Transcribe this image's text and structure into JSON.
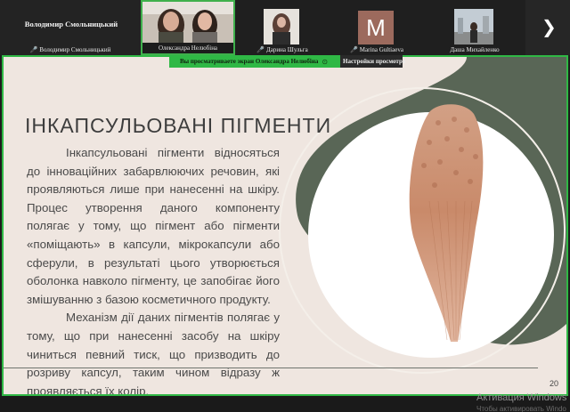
{
  "participants": {
    "featured": {
      "display_name": "Володимир Смольницький",
      "tile_label": "Володимир Смольницький"
    },
    "tiles": [
      {
        "label": "Олександра Нелюбіна",
        "muted": false,
        "active": true
      },
      {
        "label": "Дарина Шульга",
        "muted": true,
        "active": false
      },
      {
        "label": "Marina Gultiaeva",
        "muted": true,
        "active": false,
        "avatar_letter": "M"
      },
      {
        "label": "Даша Михайленко",
        "muted": false,
        "active": false
      }
    ]
  },
  "share_banner": {
    "text": "Вы просматриваете экран  Олександра Нелюбіна",
    "view_settings": "Настройки просмотра"
  },
  "slide": {
    "title": "ІНКАПСУЛЬОВАНІ ПІГМЕНТИ",
    "paragraph1": "Інкапсульовані пігменти відносяться до інноваційних забарвлюючих речовин, які проявляються лише при нанесенні на шкіру. Процес утворення даного компоненту полягає у тому, що пігмент або пігменти «поміщають» в капсули, мікрокапсули або сферули, в результаті цього утворюється оболонка навколо пігменту, це запобігає його змішуванню з базою косметичного продукту.",
    "paragraph2": "Механізм дії даних пігментів полягає у тому, що при нанесенні засобу на шкіру чиниться певний тиск, що призводить до розриву капсул, таким чином відразу ж проявляється їх колір.",
    "page_number": "20"
  },
  "windows_watermark": {
    "line1": "Активация Windows",
    "line2": "Чтобы активировать Windo"
  },
  "colors": {
    "active_border": "#2fb845",
    "slide_bg": "#efe6e0",
    "dark_green_shape": "#596656",
    "mic_muted": "#d9262b"
  }
}
